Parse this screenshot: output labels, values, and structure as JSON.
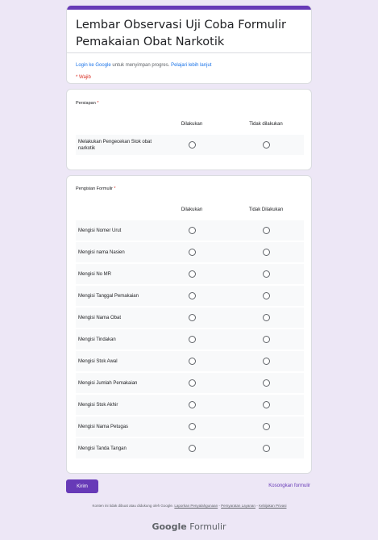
{
  "header": {
    "title": "Lembar Observasi Uji Coba Formulir Pemakaian Obat Narkotik",
    "login_link": "Login ke Google",
    "login_text": " untuk menyimpan progres. ",
    "learn_more": "Pelajari lebih lanjut",
    "required_note": "* Wajib"
  },
  "section1": {
    "title": "Persiapan",
    "star": "*",
    "col1": "Dilakukan",
    "col2": "Tidak dilakukan",
    "rows": [
      "Melakukan Pengecekan Stok obat narkotik"
    ]
  },
  "section2": {
    "title": "Pengisian Formulir",
    "star": "*",
    "col1": "Dilakukan",
    "col2": "Tidak Dilakukan",
    "rows": [
      "Mengisi Nomer Urut",
      "Mengisi nama Nasien",
      "Mengisi No MR",
      "Mengisi Tanggal Pemakaian",
      "Mengisi Nama Obat",
      "Mengisi Tindakan",
      "Mengisi Stok Awal",
      "Mengisi Jumlah Pemakaian",
      "Mengisi Stok Akhir",
      "Mengisi Nama Petugas",
      "Mengisi Tanda Tangan"
    ]
  },
  "actions": {
    "submit": "Kirim",
    "clear": "Kosongkan formulir"
  },
  "footer": {
    "disclaimer": "Konten ini tidak dibuat atau didukung oleh Google. ",
    "report": "Laporkan Penyalahgunaan",
    "sep1": " - ",
    "terms": "Persyaratan Layanan",
    "sep2": " - ",
    "privacy": "Kebijakan Privasi",
    "brand_google": "Google",
    "brand_forms": " Formulir"
  },
  "colors": {
    "accent": "#673ab7",
    "background": "#ede7f6",
    "required": "#d93025",
    "link": "#1a73e8"
  }
}
